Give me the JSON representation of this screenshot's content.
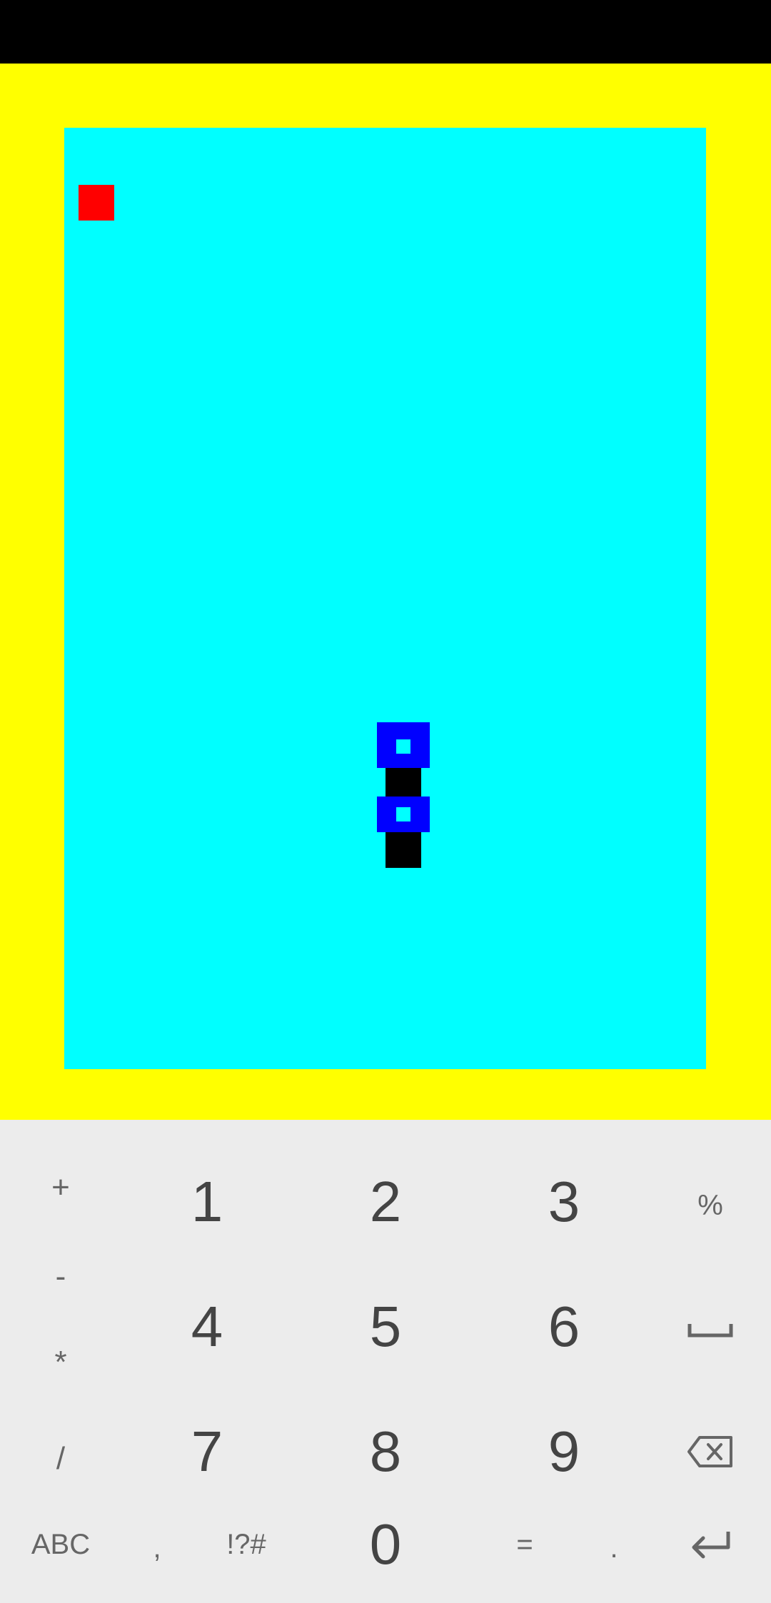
{
  "game": {
    "colors": {
      "background": "#ffff00",
      "board": "#00ffff",
      "food": "#ff0000",
      "snake_head": "#0000ff",
      "snake_body": "#000000"
    }
  },
  "keyboard": {
    "row1": {
      "left": "+",
      "k1": "1",
      "k2": "2",
      "k3": "3",
      "right": "%"
    },
    "row2": {
      "left": "-",
      "k1": "4",
      "k2": "5",
      "k3": "6",
      "right_icon": "space-icon"
    },
    "row2b": {
      "left": "*"
    },
    "row3": {
      "left": "/",
      "k1": "7",
      "k2": "8",
      "k3": "9",
      "right_icon": "backspace-icon"
    },
    "row4": {
      "abc": "ABC",
      "comma": ",",
      "symbols": "!?#",
      "zero": "0",
      "equals": "=",
      "dot": ".",
      "enter_icon": "enter-icon"
    }
  }
}
